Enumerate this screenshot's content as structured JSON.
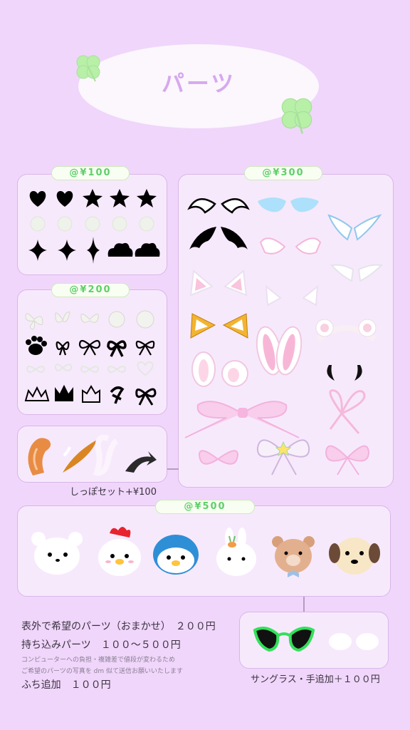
{
  "title": "パーツ",
  "badges": {
    "p100": "@¥100",
    "p300": "@¥300",
    "p200": "@¥200",
    "p500": "@¥500"
  },
  "tail_label": "しっぽセット+¥100",
  "notes": {
    "line1": "表外で希望のパーツ（おまかせ）　２００円",
    "line2": "持ち込みパーツ　１００〜５００円",
    "small1": "コンピューターへの負担・複雑差で値段が変わるため",
    "small2": "ご希望のパーツの写真を dm 似て送信お願いいたします",
    "line3": "ふち追加　１００円"
  },
  "sunglasses_label": "サングラス・手追加＋１００円",
  "colors": {
    "background": "#f0d6fb",
    "panel": "#f7e9fc",
    "badge_text": "#5fcf6b",
    "title": "#d6a9ee",
    "clover": "#b8f0a8"
  },
  "icons": {
    "row100_1": [
      "heart-icon",
      "heart-icon",
      "star-icon",
      "star-icon",
      "star-icon"
    ],
    "row100_2": [
      "flower-icon",
      "flower-icon",
      "flower-icon",
      "flower-icon",
      "flower-icon"
    ],
    "row100_3": [
      "sparkle-icon",
      "sparkle-icon",
      "sparkle-icon",
      "cloud-icon",
      "cloud-icon"
    ],
    "row200": [
      "butterfly-icon",
      "paw-icon",
      "ribbon-icon",
      "crown-icon"
    ],
    "row300": [
      "wing-icon",
      "animal-ear-icon",
      "bunny-ear-icon",
      "bow-icon"
    ],
    "row500": [
      "bear-head-icon",
      "chick-head-icon",
      "penguin-head-icon",
      "bunny-head-icon",
      "bear-bowtie-head-icon",
      "dog-head-icon"
    ]
  }
}
